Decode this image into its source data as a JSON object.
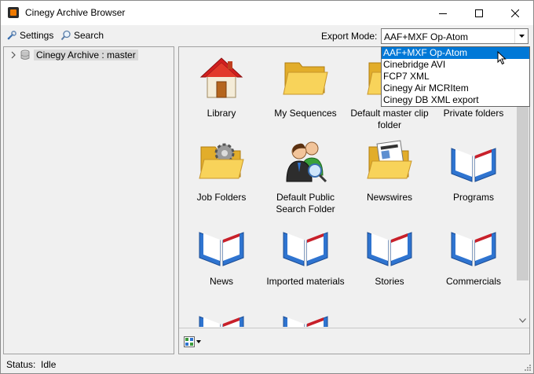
{
  "window": {
    "title": "Cinegy Archive Browser",
    "buttons": [
      "minimize-icon",
      "maximize-icon",
      "close-icon"
    ]
  },
  "toolbar": {
    "settings_label": "Settings",
    "search_label": "Search",
    "export_label": "Export Mode:",
    "export_value": "AAF+MXF Op-Atom",
    "export_options": [
      "AAF+MXF Op-Atom",
      "Cinebridge AVI",
      "FCP7 XML",
      "Cinegy Air MCRItem",
      "Cinegy DB XML export"
    ]
  },
  "tree": {
    "root_label": "Cinegy Archive : master"
  },
  "tiles": [
    {
      "label": "Library",
      "icon": "library-house-icon"
    },
    {
      "label": "My Sequences",
      "icon": "folder-icon"
    },
    {
      "label": "Default master clip folder",
      "icon": "folder-icon"
    },
    {
      "label": "Private folders",
      "icon": "folder-icon"
    },
    {
      "label": "Job Folders",
      "icon": "gear-folder-icon"
    },
    {
      "label": "Default Public Search Folder",
      "icon": "people-search-icon"
    },
    {
      "label": "Newswires",
      "icon": "newspaper-folder-icon"
    },
    {
      "label": "Programs",
      "icon": "book-icon"
    },
    {
      "label": "News",
      "icon": "book-icon"
    },
    {
      "label": "Imported materials",
      "icon": "book-icon"
    },
    {
      "label": "Stories",
      "icon": "book-icon"
    },
    {
      "label": "Commercials",
      "icon": "book-icon"
    },
    {
      "label": "",
      "icon": "book-icon"
    },
    {
      "label": "",
      "icon": "book-icon"
    }
  ],
  "status": {
    "label": "Status:",
    "value": "Idle"
  },
  "colors": {
    "selection": "#0078d7",
    "folder": "#f5c842",
    "book_blue": "#2f74d0",
    "book_red": "#c8202a"
  }
}
